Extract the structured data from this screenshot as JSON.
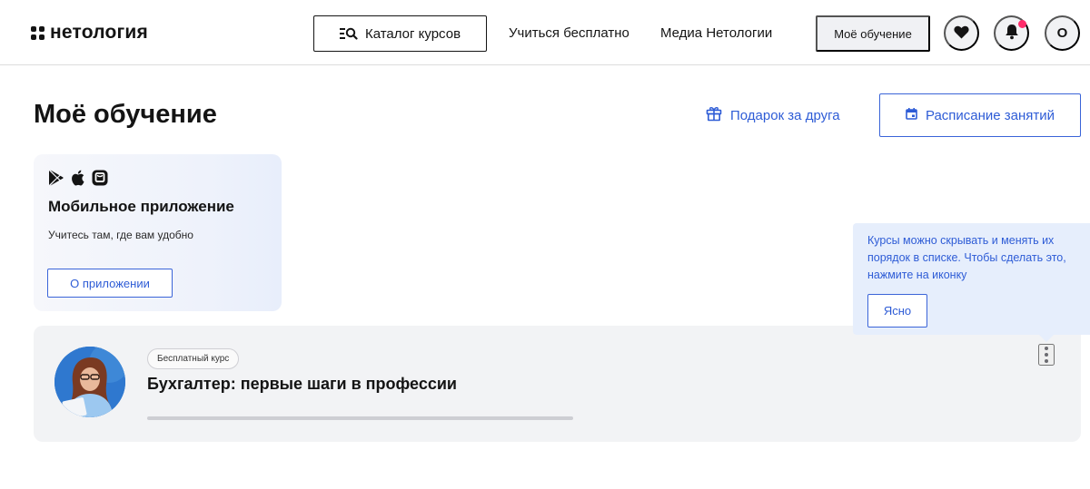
{
  "header": {
    "logo_text": "нетология",
    "catalog_label": "Каталог курсов",
    "nav_free": "Учиться бесплатно",
    "nav_media": "Медиа Нетологии",
    "my_learning": "Моё обучение",
    "profile_initial": "О",
    "icons": [
      "catalog-search-icon",
      "heart-icon",
      "bell-icon"
    ],
    "notification_color": "#ff2d6b"
  },
  "page": {
    "title": "Моё обучение",
    "gift_link": "Подарок за друга",
    "schedule_label": "Расписание занятий",
    "accent_color": "#2e5cd6"
  },
  "app_card": {
    "title": "Мобильное приложение",
    "subtitle": "Учитесь там, где вам удобно",
    "button_label": "О приложении",
    "store_icons": [
      "google-play-icon",
      "apple-icon",
      "app-gallery-icon"
    ]
  },
  "course": {
    "badge": "Бесплатный курс",
    "title": "Бухгалтер: первые шаги в профессии",
    "progress": 0.0
  },
  "tooltip": {
    "text": "Курсы можно скрывать и менять их порядок в списке. Чтобы сделать это, нажмите на иконку",
    "button_label": "Ясно"
  }
}
